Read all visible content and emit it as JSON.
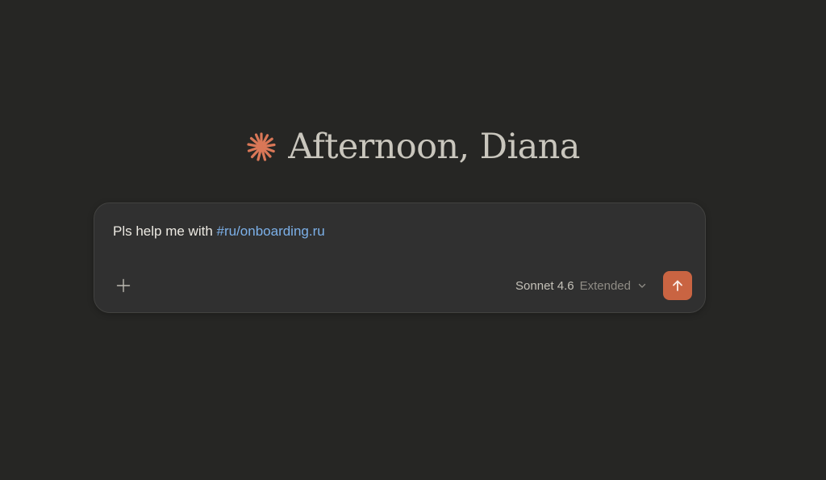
{
  "greeting": {
    "text": "Afternoon, Diana",
    "logo_icon": "sparkle-asterisk-icon",
    "logo_color": "#d97757"
  },
  "composer": {
    "prompt_text": "Pls help me with ",
    "mention": "#ru/onboarding.ru",
    "add_icon": "plus-icon",
    "model": {
      "name": "Sonnet 4.6",
      "mode": "Extended",
      "dropdown_icon": "chevron-down-icon"
    },
    "send_icon": "arrow-up-icon",
    "send_color": "#c96442"
  },
  "colors": {
    "background": "#262624",
    "composer_bg": "#303030",
    "mention": "#7cb0e8"
  }
}
